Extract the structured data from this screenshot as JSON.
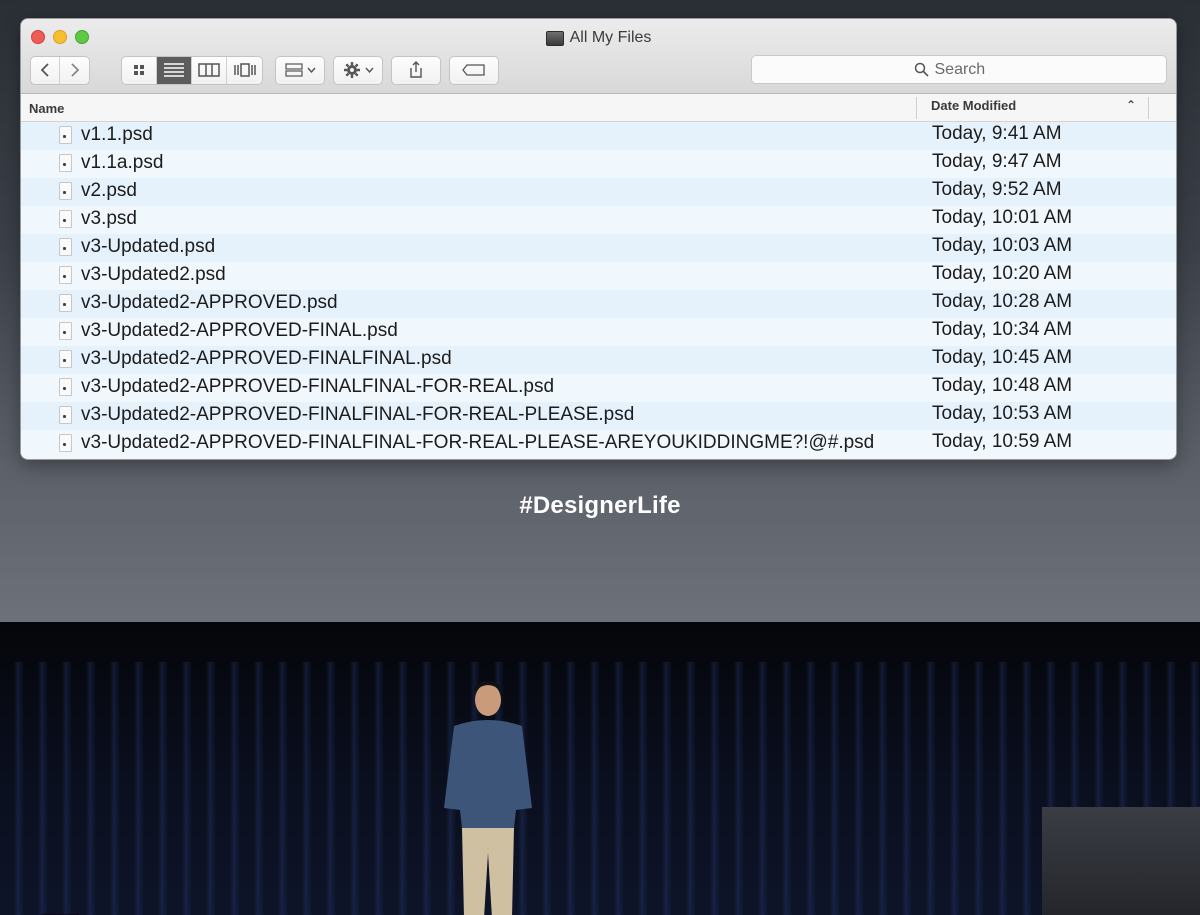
{
  "window": {
    "title": "All My Files"
  },
  "toolbar": {
    "search_placeholder": "Search"
  },
  "columns": {
    "name": "Name",
    "date_modified": "Date Modified"
  },
  "files": [
    {
      "name": "v1.1.psd",
      "date": "Today, 9:41 AM"
    },
    {
      "name": "v1.1a.psd",
      "date": "Today, 9:47 AM"
    },
    {
      "name": "v2.psd",
      "date": "Today, 9:52 AM"
    },
    {
      "name": "v3.psd",
      "date": "Today, 10:01 AM"
    },
    {
      "name": "v3-Updated.psd",
      "date": "Today, 10:03 AM"
    },
    {
      "name": "v3-Updated2.psd",
      "date": "Today, 10:20 AM"
    },
    {
      "name": "v3-Updated2-APPROVED.psd",
      "date": "Today, 10:28 AM"
    },
    {
      "name": "v3-Updated2-APPROVED-FINAL.psd",
      "date": "Today, 10:34 AM"
    },
    {
      "name": "v3-Updated2-APPROVED-FINALFINAL.psd",
      "date": "Today, 10:45 AM"
    },
    {
      "name": "v3-Updated2-APPROVED-FINALFINAL-FOR-REAL.psd",
      "date": "Today, 10:48 AM"
    },
    {
      "name": "v3-Updated2-APPROVED-FINALFINAL-FOR-REAL-PLEASE.psd",
      "date": "Today, 10:53 AM"
    },
    {
      "name": "v3-Updated2-APPROVED-FINALFINAL-FOR-REAL-PLEASE-AREYOUKIDDINGME?!@#.psd",
      "date": "Today, 10:59 AM"
    }
  ],
  "caption": "#DesignerLife",
  "colors": {
    "close": "#ee5c56",
    "minimize": "#f5bf2f",
    "zoom": "#5fc844",
    "row_alt": "#e6f2fb"
  },
  "icons": [
    "back-chevron",
    "forward-chevron",
    "icon-view",
    "list-view",
    "column-view",
    "cover-flow-view",
    "arrange-menu",
    "action-gear",
    "share",
    "tag",
    "search"
  ]
}
